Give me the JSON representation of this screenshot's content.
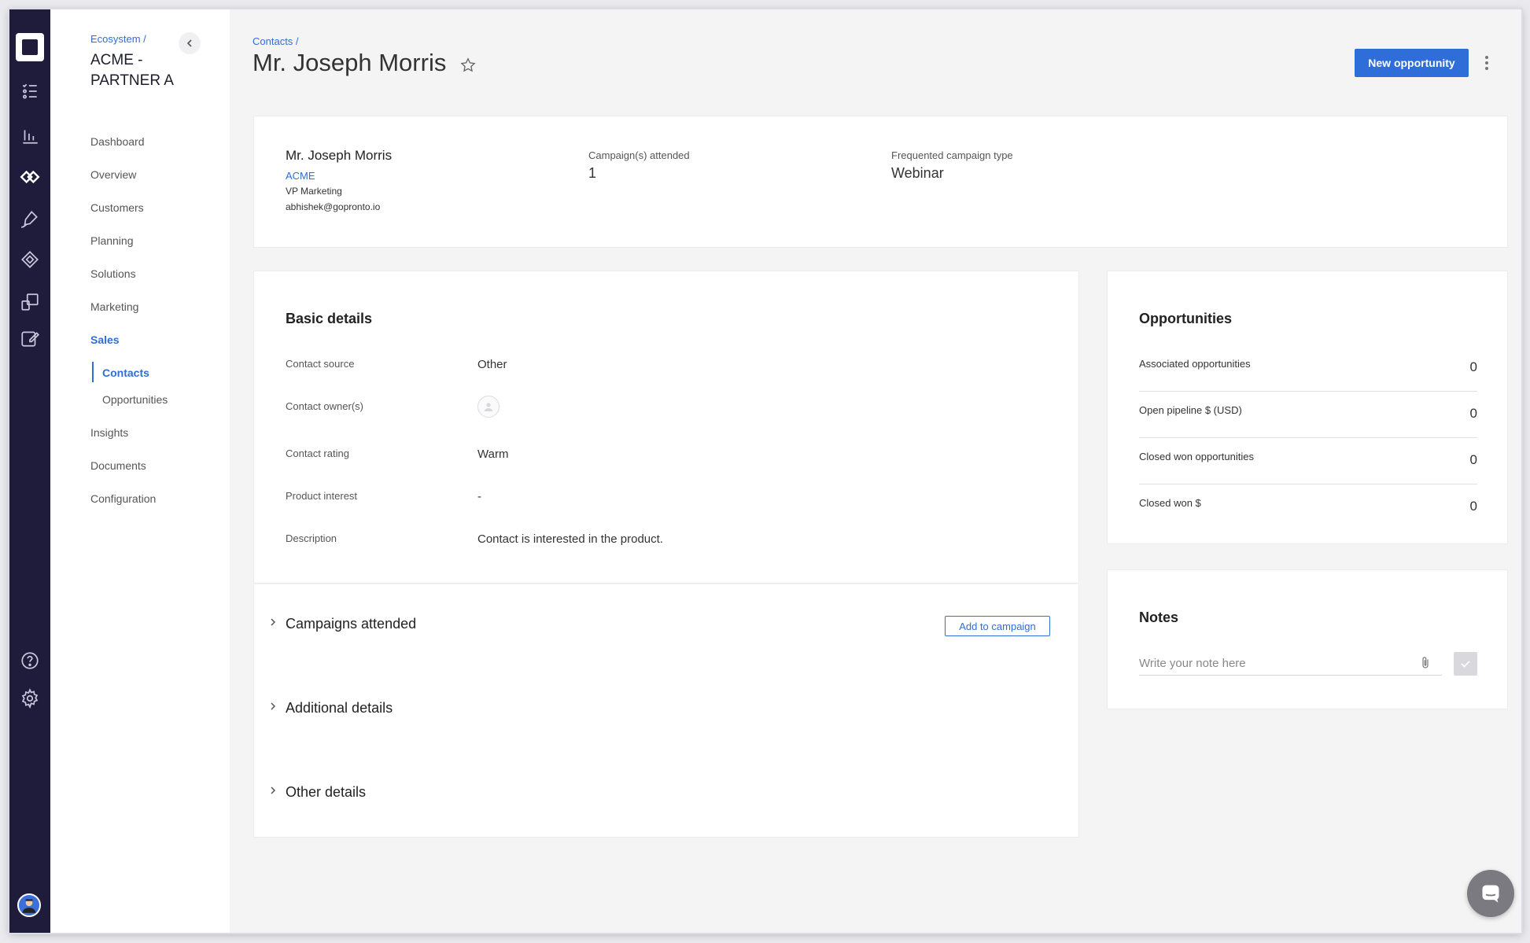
{
  "sidebar": {
    "breadcrumb": "Ecosystem /",
    "org_name": "ACME - PARTNER A",
    "items": [
      {
        "label": "Dashboard"
      },
      {
        "label": "Overview"
      },
      {
        "label": "Customers"
      },
      {
        "label": "Planning"
      },
      {
        "label": "Solutions"
      },
      {
        "label": "Marketing"
      },
      {
        "label": "Sales"
      },
      {
        "label": "Contacts"
      },
      {
        "label": "Opportunities"
      },
      {
        "label": "Insights"
      },
      {
        "label": "Documents"
      },
      {
        "label": "Configuration"
      }
    ]
  },
  "header": {
    "breadcrumb": "Contacts /",
    "title": "Mr. Joseph Morris",
    "new_opportunity_label": "New opportunity"
  },
  "summary": {
    "name": "Mr. Joseph Morris",
    "company": "ACME",
    "role": "VP Marketing",
    "email": "abhishek@gopronto.io",
    "campaigns_label": "Campaign(s) attended",
    "campaigns_value": "1",
    "type_label": "Frequented campaign type",
    "type_value": "Webinar"
  },
  "basic_details": {
    "title": "Basic details",
    "fields": [
      {
        "label": "Contact source",
        "value": "Other"
      },
      {
        "label": "Contact owner(s)",
        "value": ""
      },
      {
        "label": "Contact rating",
        "value": "Warm"
      },
      {
        "label": "Product interest",
        "value": "-"
      },
      {
        "label": "Description",
        "value": "Contact is interested in the product."
      }
    ]
  },
  "sections": {
    "campaigns_title": "Campaigns attended",
    "add_to_campaign_label": "Add to campaign",
    "additional_title": "Additional details",
    "other_title": "Other details"
  },
  "opportunities": {
    "title": "Opportunities",
    "rows": [
      {
        "label": "Associated opportunities",
        "value": "0"
      },
      {
        "label": "Open pipeline $ (USD)",
        "value": "0"
      },
      {
        "label": "Closed won opportunities",
        "value": "0"
      },
      {
        "label": "Closed won $",
        "value": "0"
      }
    ]
  },
  "notes": {
    "title": "Notes",
    "placeholder": "Write your note here"
  },
  "icons": {
    "rail": [
      "app-logo-icon",
      "tasks-icon",
      "analytics-icon",
      "ecosystem-icon",
      "pen-icon",
      "handshake-icon",
      "shapes-icon",
      "edit-icon",
      "help-icon",
      "settings-icon",
      "user-avatar-icon"
    ],
    "other": [
      "star-icon",
      "kebab-menu-icon",
      "chevron-left-icon",
      "chevron-right-icon",
      "paperclip-icon",
      "check-icon",
      "chat-icon"
    ]
  },
  "colors": {
    "accent": "#2f6ed8",
    "rail": "#1f1b3a"
  }
}
